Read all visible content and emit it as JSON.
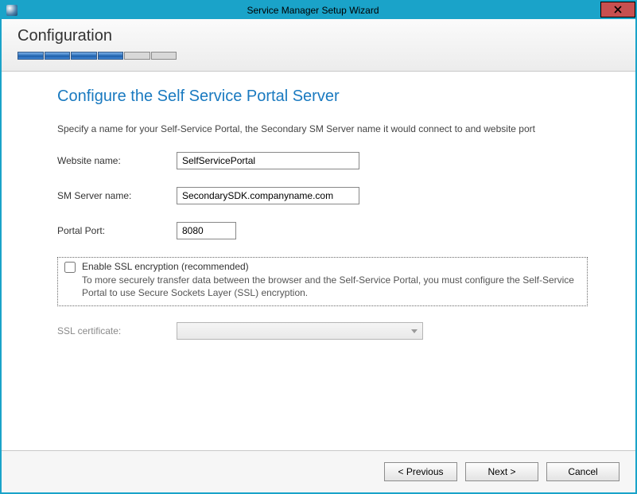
{
  "window": {
    "title": "Service Manager Setup Wizard"
  },
  "header": {
    "section": "Configuration",
    "progress_total": 6,
    "progress_done": 4
  },
  "page": {
    "title": "Configure the Self Service Portal Server",
    "instruction": "Specify a name for your Self-Service Portal, the Secondary SM Server name it would connect to and website port"
  },
  "fields": {
    "website_label": "Website name:",
    "website_value": "SelfServicePortal",
    "server_label": "SM Server name:",
    "server_value": "SecondarySDK.companyname.com",
    "port_label": "Portal Port:",
    "port_value": "8080"
  },
  "ssl": {
    "title": "Enable SSL encryption (recommended)",
    "description": "To more securely transfer data between the browser and the Self-Service Portal, you must configure the Self-Service Portal to use Secure Sockets Layer (SSL) encryption.",
    "cert_label": "SSL certificate:"
  },
  "buttons": {
    "previous": "< Previous",
    "next": "Next >",
    "cancel": "Cancel"
  }
}
